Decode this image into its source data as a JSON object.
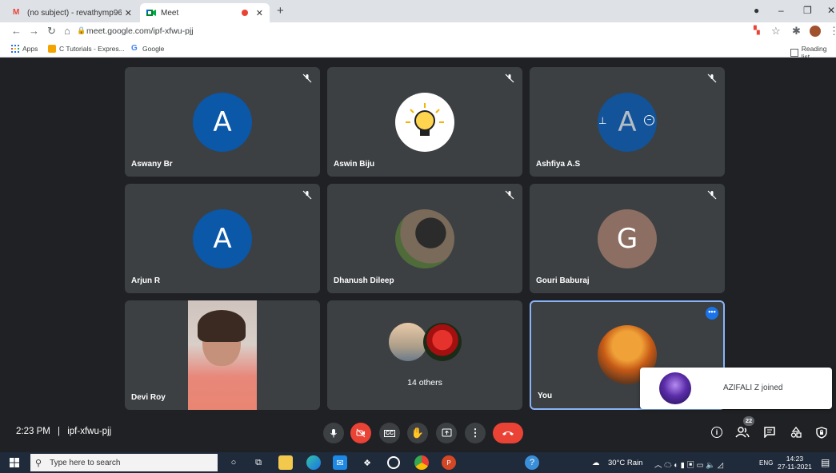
{
  "browser": {
    "tabs": [
      {
        "icon": "gmail-icon",
        "title": "(no subject) - revathymp96@gm..."
      },
      {
        "icon": "meet-icon",
        "title": "Meet"
      }
    ],
    "url": "meet.google.com/ipf-xfwu-pjj",
    "bookmarks": [
      "Apps",
      "C Tutorials - Expres...",
      "Google"
    ],
    "reading_list": "Reading list"
  },
  "participants": [
    {
      "name": "Aswany Br",
      "initial": "A",
      "color": "#0b57a8",
      "muted": true
    },
    {
      "name": "Aswin Biju",
      "initial": "",
      "color": "#ffffff",
      "muted": true,
      "image": "lightbulb"
    },
    {
      "name": "Ashfiya A.S",
      "initial": "A",
      "color": "#0b57a8",
      "muted": true
    },
    {
      "name": "Arjun R",
      "initial": "A",
      "color": "#0b57a8",
      "muted": true
    },
    {
      "name": "Dhanush Dileep",
      "initial": "",
      "color": "#6e5a4a",
      "muted": true,
      "image": "photo"
    },
    {
      "name": "Gouri Baburaj",
      "initial": "G",
      "color": "#8d6e63",
      "muted": true
    },
    {
      "name": "Devi Roy",
      "initial": "",
      "color": "#e58a6e",
      "muted": false,
      "image": "video"
    },
    {
      "name": "14 others",
      "initial": "",
      "color": "#555",
      "muted": false,
      "image": "group"
    },
    {
      "name": "You",
      "initial": "",
      "color": "#c6651f",
      "muted": false,
      "image": "tree"
    }
  ],
  "meeting": {
    "time": "2:23 PM",
    "separator": "|",
    "code": "ipf-xfwu-pjj",
    "participant_count": "22"
  },
  "toast": {
    "text": "AZIFALI Z joined"
  },
  "taskbar": {
    "search_placeholder": "Type here to search",
    "weather": "30°C Rain",
    "lang": "ENG",
    "time": "14:23",
    "date": "27-11-2021"
  },
  "colors": {
    "end_call": "#ea4335",
    "active_border": "#8ab4f8",
    "tile_bg": "#3c4043"
  }
}
